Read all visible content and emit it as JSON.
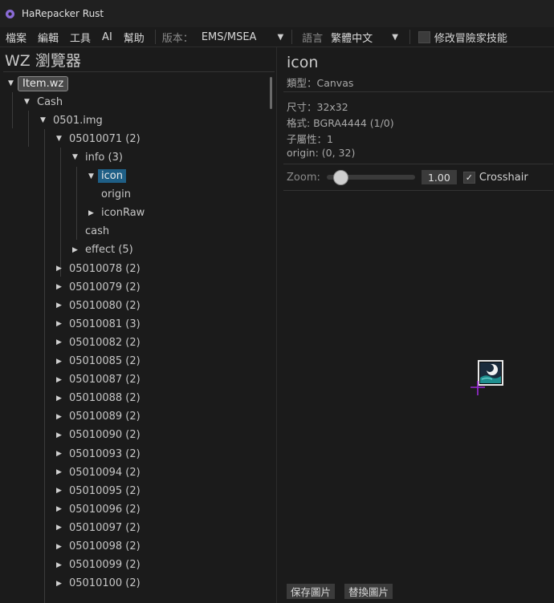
{
  "app": {
    "title": "HaRepacker Rust",
    "icon": "gear-icon"
  },
  "menu": {
    "items": [
      "檔案",
      "編輯",
      "工具",
      "AI",
      "幫助"
    ],
    "version_label": "版本：",
    "version_value": "EMS/MSEA",
    "language_label": "語言",
    "language_value": "繁體中文",
    "modify_label": "修改冒險家技能"
  },
  "left_panel": {
    "title": "WZ 瀏覽器",
    "tree": [
      {
        "label": "Item.wz",
        "depth": 0,
        "state": "open",
        "style": "root"
      },
      {
        "label": "Cash",
        "depth": 1,
        "state": "open"
      },
      {
        "label": "0501.img",
        "depth": 2,
        "state": "open"
      },
      {
        "label": "05010071 (2)",
        "depth": 3,
        "state": "open"
      },
      {
        "label": "info (3)",
        "depth": 4,
        "state": "open"
      },
      {
        "label": "icon",
        "depth": 5,
        "state": "open",
        "style": "selected"
      },
      {
        "label": "origin",
        "depth": 5,
        "state": "leaf"
      },
      {
        "label": "iconRaw",
        "depth": 5,
        "state": "closed"
      },
      {
        "label": "cash",
        "depth": 4,
        "state": "leaf"
      },
      {
        "label": "effect (5)",
        "depth": 4,
        "state": "closed"
      },
      {
        "label": "05010078 (2)",
        "depth": 3,
        "state": "closed"
      },
      {
        "label": "05010079 (2)",
        "depth": 3,
        "state": "closed"
      },
      {
        "label": "05010080 (2)",
        "depth": 3,
        "state": "closed"
      },
      {
        "label": "05010081 (3)",
        "depth": 3,
        "state": "closed"
      },
      {
        "label": "05010082 (2)",
        "depth": 3,
        "state": "closed"
      },
      {
        "label": "05010085 (2)",
        "depth": 3,
        "state": "closed"
      },
      {
        "label": "05010087 (2)",
        "depth": 3,
        "state": "closed"
      },
      {
        "label": "05010088 (2)",
        "depth": 3,
        "state": "closed"
      },
      {
        "label": "05010089 (2)",
        "depth": 3,
        "state": "closed"
      },
      {
        "label": "05010090 (2)",
        "depth": 3,
        "state": "closed"
      },
      {
        "label": "05010093 (2)",
        "depth": 3,
        "state": "closed"
      },
      {
        "label": "05010094 (2)",
        "depth": 3,
        "state": "closed"
      },
      {
        "label": "05010095 (2)",
        "depth": 3,
        "state": "closed"
      },
      {
        "label": "05010096 (2)",
        "depth": 3,
        "state": "closed"
      },
      {
        "label": "05010097 (2)",
        "depth": 3,
        "state": "closed"
      },
      {
        "label": "05010098 (2)",
        "depth": 3,
        "state": "closed"
      },
      {
        "label": "05010099 (2)",
        "depth": 3,
        "state": "closed"
      },
      {
        "label": "05010100 (2)",
        "depth": 3,
        "state": "closed"
      }
    ]
  },
  "right_panel": {
    "title": "icon",
    "type_line": "類型：Canvas",
    "size_line": "尺寸：32x32",
    "format_line": "格式: BGRA4444 (1/0)",
    "children_line": "子屬性：1",
    "origin_line": "origin: (0, 32)",
    "zoom_label": "Zoom:",
    "zoom_value": "1.00",
    "zoom_slider_fraction": 0.07,
    "crosshair_label": "Crosshair",
    "crosshair_checked": "✓",
    "save_button": "保存圖片",
    "replace_button": "替換圖片"
  },
  "colors": {
    "background": "#1b1b1b",
    "selection": "#1f5f86",
    "crosshair": "#9b2bd6",
    "app_icon": "#8a6bd6"
  }
}
